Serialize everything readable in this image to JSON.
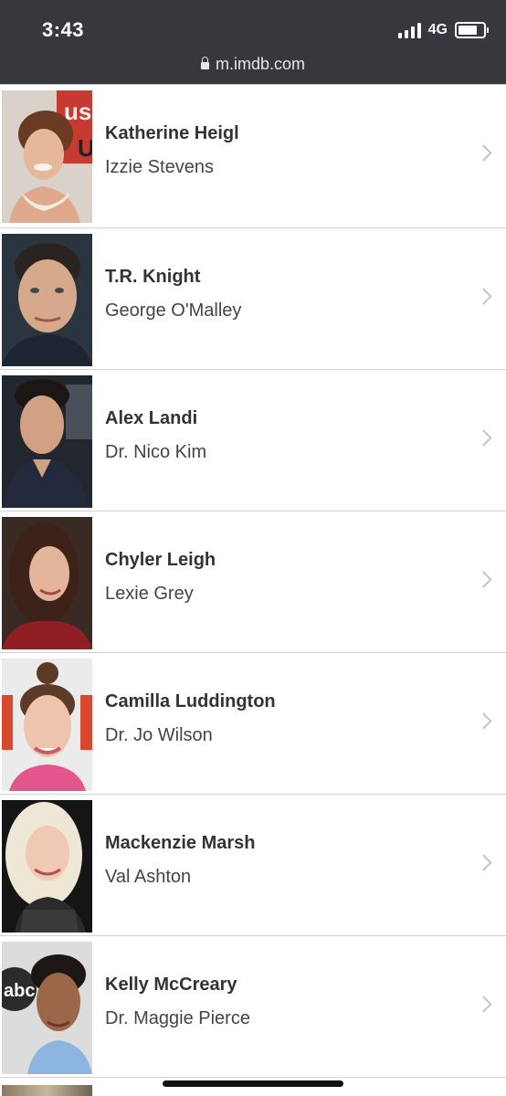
{
  "status_bar": {
    "time": "3:43",
    "network": "4G",
    "icons": [
      "signal-bars-icon",
      "battery-icon"
    ]
  },
  "browser": {
    "url": "m.imdb.com",
    "icons": [
      "lock-icon"
    ]
  },
  "cast": [
    {
      "actor": "Katherine Heigl",
      "character": "Izzie Stevens"
    },
    {
      "actor": "T.R. Knight",
      "character": "George O'Malley"
    },
    {
      "actor": "Alex Landi",
      "character": "Dr. Nico Kim"
    },
    {
      "actor": "Chyler Leigh",
      "character": "Lexie Grey"
    },
    {
      "actor": "Camilla Luddington",
      "character": "Dr. Jo Wilson"
    },
    {
      "actor": "Mackenzie Marsh",
      "character": "Val Ashton"
    },
    {
      "actor": "Kelly McCreary",
      "character": "Dr. Maggie Pierce"
    }
  ],
  "colors": {
    "top_bar": "#37383d",
    "divider": "#d3d3d3",
    "actor_text": "#333333",
    "chevron": "#c4c4c4"
  }
}
